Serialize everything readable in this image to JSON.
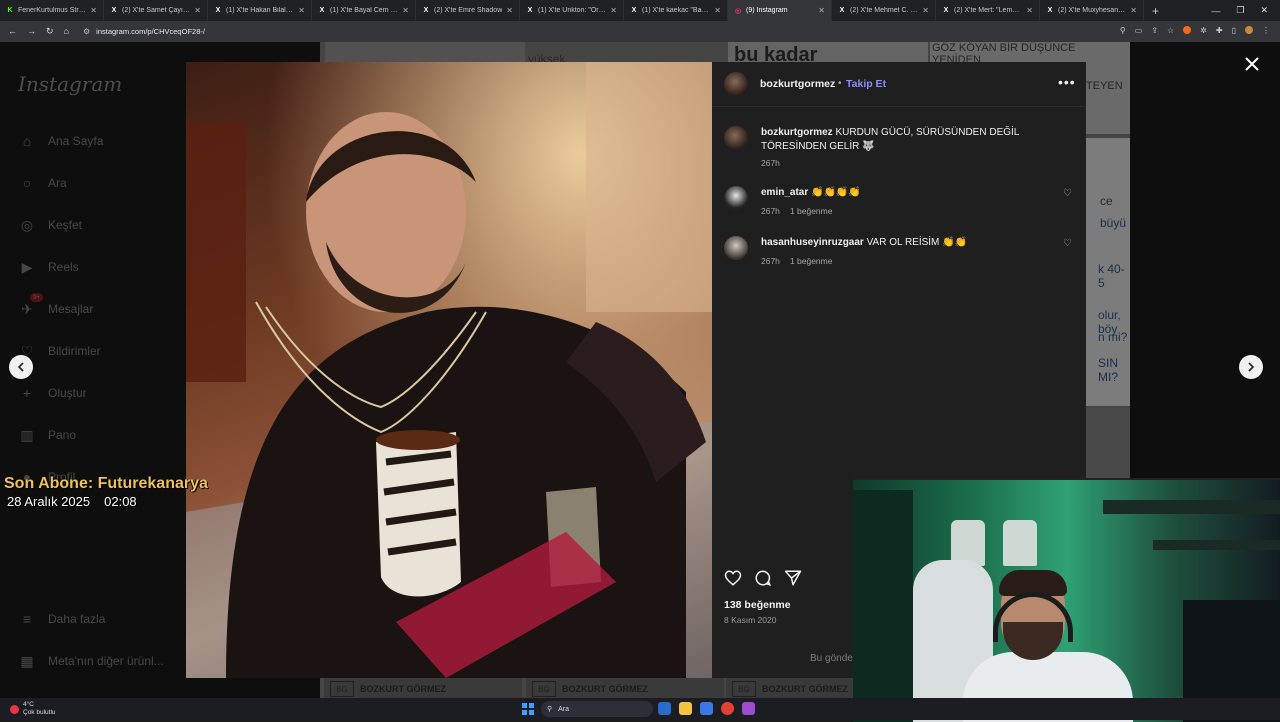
{
  "browser": {
    "tabs": [
      {
        "label": "FenerKurtulmus Stream",
        "icon": "kick-icon",
        "color": "#53fc18",
        "glyph": "K"
      },
      {
        "label": "(2) X'te Samet Çayır: \"@ferd",
        "icon": "x-icon",
        "color": "#ffffff",
        "glyph": "X"
      },
      {
        "label": "(1) X'te Hakan Bilal Kutlu",
        "icon": "x-icon",
        "color": "#ffffff",
        "glyph": "X"
      },
      {
        "label": "(1) X'te Bayal Cem Özbek",
        "icon": "x-icon",
        "color": "#ffffff",
        "glyph": "X"
      },
      {
        "label": "(2) X'te Emre Shadow",
        "icon": "x-icon",
        "color": "#ffffff",
        "glyph": "X"
      },
      {
        "label": "(1) X'te Ünkton: \"Örnek ü",
        "icon": "x-icon",
        "color": "#ffffff",
        "glyph": "X"
      },
      {
        "label": "(1) X'te kaekac \"Başkan Sa",
        "icon": "x-icon",
        "color": "#ffffff",
        "glyph": "X"
      },
      {
        "label": "(9) Instagram",
        "icon": "instagram-icon",
        "color": "#e1306c",
        "glyph": "◎"
      },
      {
        "label": "(2) X'te Mehmet C. K: \"Ke",
        "icon": "x-icon",
        "color": "#ffffff",
        "glyph": "X"
      },
      {
        "label": "(2) X'te Mert: \"Lemedi abi",
        "icon": "x-icon",
        "color": "#ffffff",
        "glyph": "X"
      },
      {
        "label": "(2) X'te Muxyhesan \"-& Ha",
        "icon": "x-icon",
        "color": "#ffffff",
        "glyph": "X"
      }
    ],
    "active_tab_index": 7,
    "new_tab_symbol": "+",
    "url": "instagram.com/p/CHVceqOF28-/"
  },
  "background_page": {
    "headline_1": "bu kadar",
    "headline_2": "GÖZ KÖYAN BİR DÜŞÜNCE YENİDEN",
    "headline_3": "TEYEN",
    "fragment_1": "yüksek",
    "fragment_2": "büyü",
    "fragment_3": "k 40-5",
    "fragment_4": "olur, böy",
    "fragment_5": "n mi?",
    "fragment_6": "SIN MI?",
    "fragment_7": "ce",
    "footer_label": "BOZKURT GÖRMEZ",
    "footer_badge": "BG"
  },
  "sidebar": {
    "logo": "Instagram",
    "items": [
      {
        "label": "Ana Sayfa",
        "icon": "home-icon",
        "glyph": "⌂"
      },
      {
        "label": "Ara",
        "icon": "search-icon",
        "glyph": "○"
      },
      {
        "label": "Keşfet",
        "icon": "compass-icon",
        "glyph": "◎"
      },
      {
        "label": "Reels",
        "icon": "reels-icon",
        "glyph": "▶"
      },
      {
        "label": "Mesajlar",
        "icon": "messenger-icon",
        "glyph": "✈"
      },
      {
        "label": "Bildirimler",
        "icon": "heart-icon",
        "glyph": "♡"
      },
      {
        "label": "Oluştur",
        "icon": "plus-icon",
        "glyph": "+"
      },
      {
        "label": "Pano",
        "icon": "dashboard-icon",
        "glyph": "▥"
      },
      {
        "label": "Profil",
        "icon": "profile-icon",
        "glyph": "●"
      },
      {
        "label": "Daha fazla",
        "icon": "menu-icon",
        "glyph": "≡"
      },
      {
        "label": "Meta'nın diğer ürünl...",
        "icon": "meta-icon",
        "glyph": "▦"
      }
    ],
    "messages_badge": "9+"
  },
  "post": {
    "username": "bozkurtgormez",
    "separator": "•",
    "follow_label": "Takip Et",
    "more_symbol": "•••",
    "caption": {
      "username": "bozkurtgormez",
      "text": "KURDUN GÜCÜ, SÜRÜSÜNDEN DEĞİL TÖRESİNDEN GELİR 🐺",
      "time": "267h"
    },
    "comments": [
      {
        "username": "emin_atar",
        "text": "👏👏👏👏",
        "time": "267h",
        "likes": "1 beğenme"
      },
      {
        "username": "hasanhuseyinruzgaar",
        "text": "VAR OL REİSİM 👏👏",
        "time": "267h",
        "likes": "1 beğenme"
      }
    ],
    "likes_count": "138 beğenme",
    "date": "8 Kasım 2020",
    "comment_placeholder": "Bu gönde"
  },
  "stream_overlay": {
    "last_sub_title": "Son Abone: Futurekanarya",
    "date": "28 Aralık 2025",
    "time": "02:08"
  },
  "taskbar": {
    "weather_temp": "4°C",
    "weather_desc": "Çok bulutlu",
    "search_label": "Ara"
  },
  "colors": {
    "follow_blue": "#8b91ff",
    "overlay_gold": "#f0c15a",
    "panel_bg": "#1f1f1f"
  }
}
